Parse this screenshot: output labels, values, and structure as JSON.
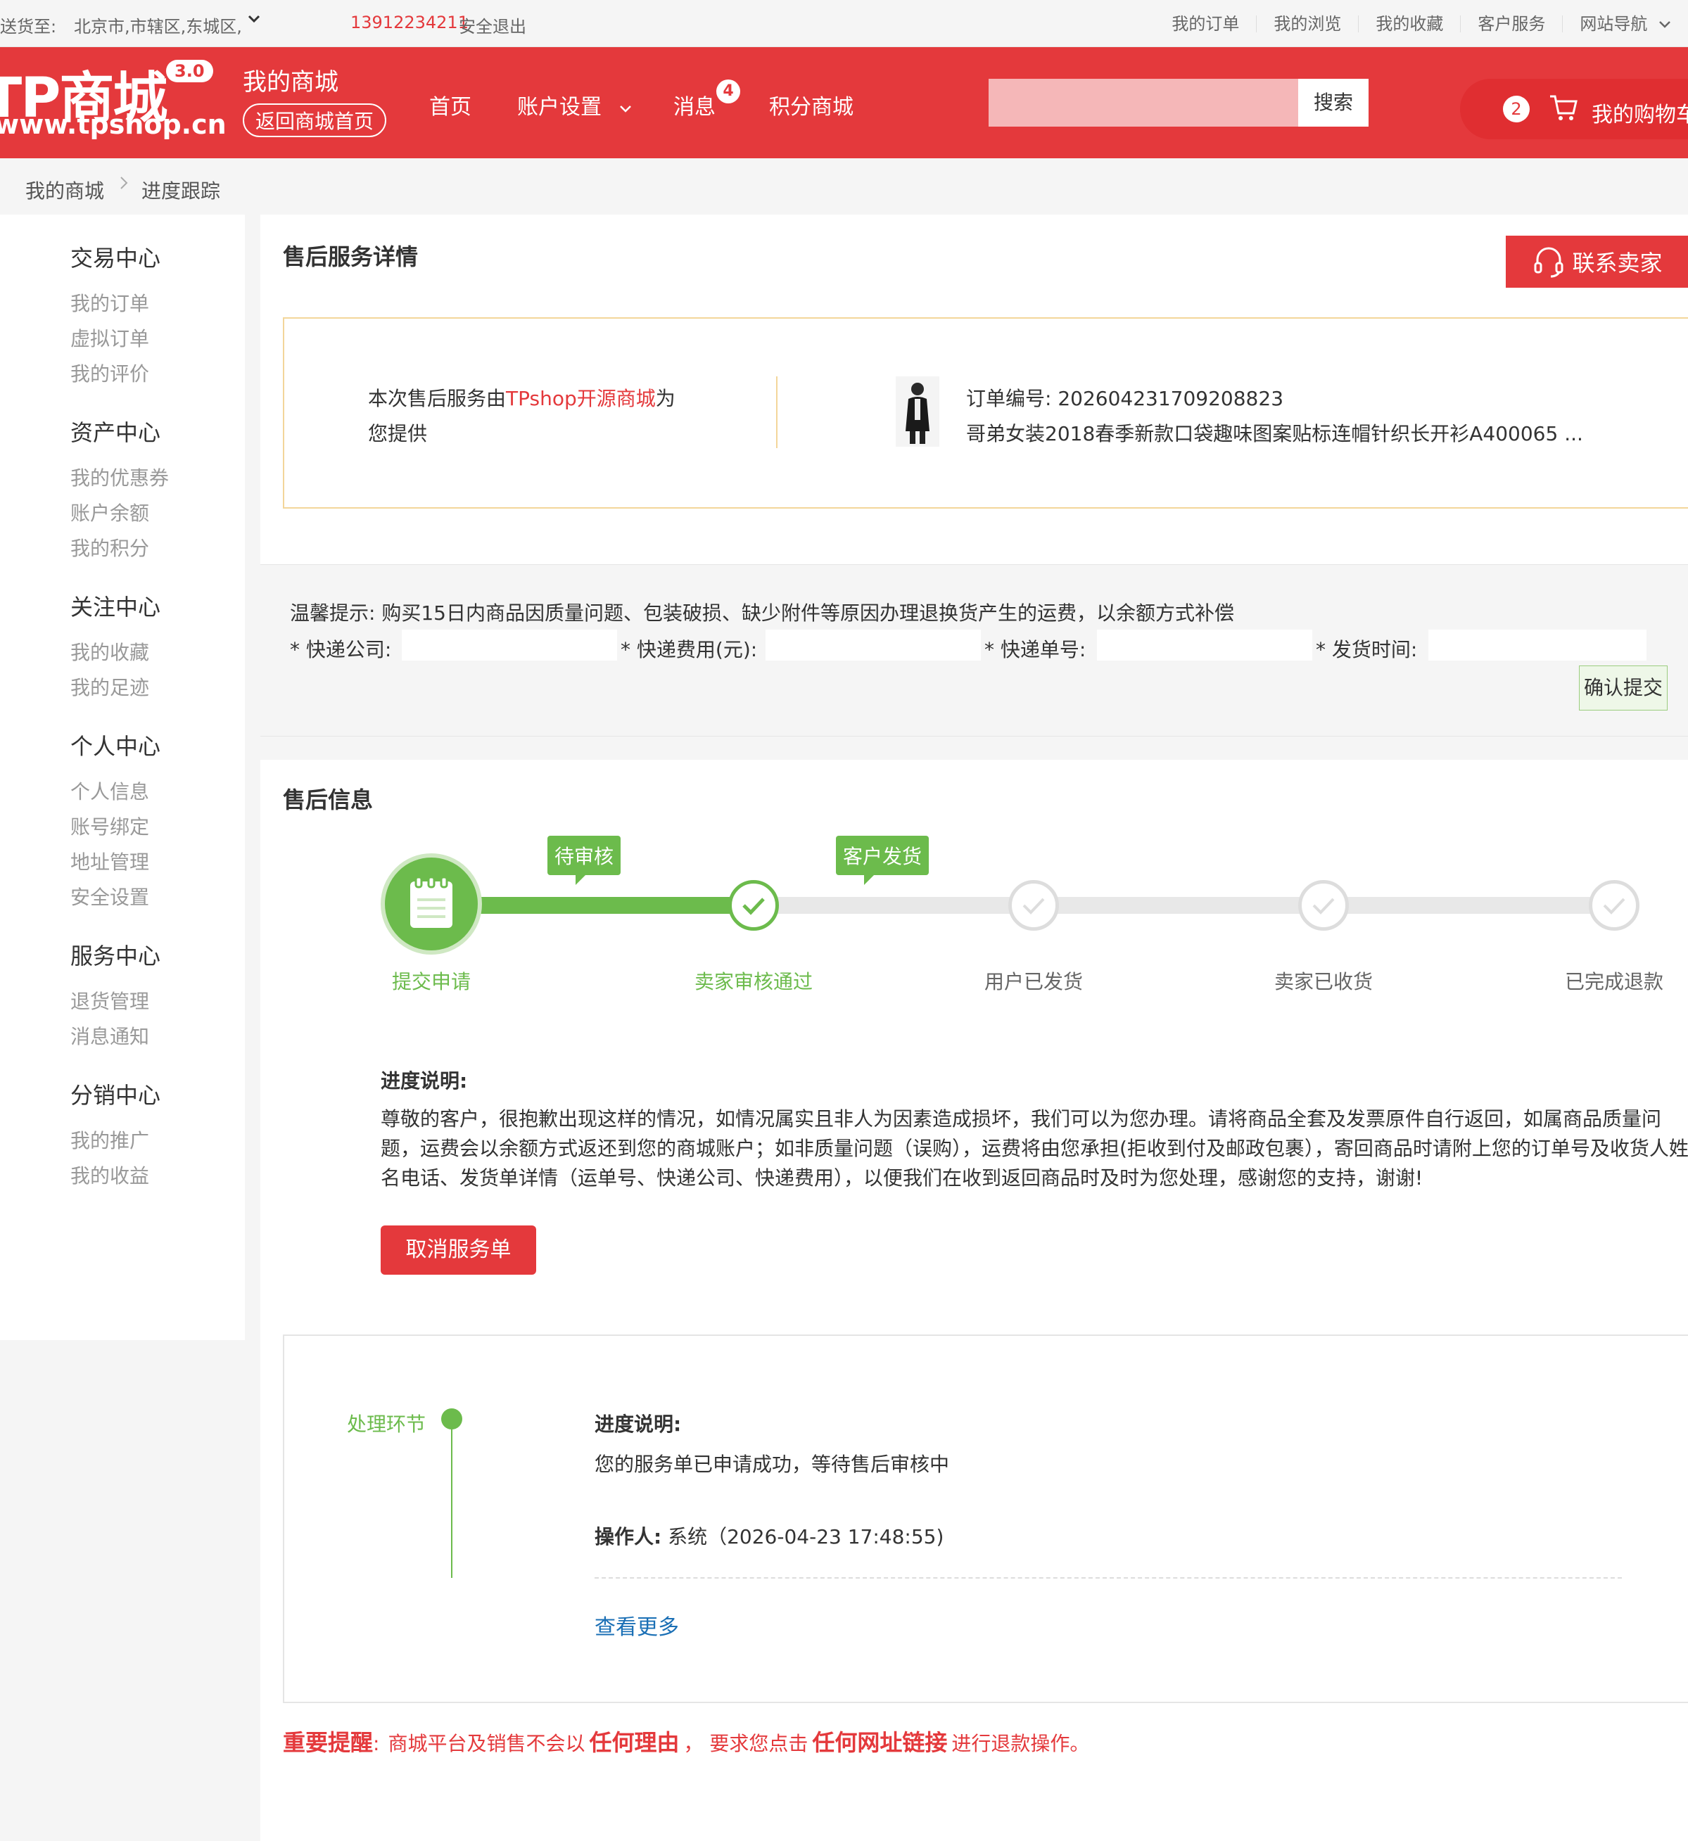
{
  "topbar": {
    "ship_to_label": "送货至:",
    "address": "北京市,市辖区,东城区,",
    "phone": "13912234211",
    "logout": "安全退出",
    "links": [
      "我的订单",
      "我的浏览",
      "我的收藏",
      "客户服务",
      "网站导航"
    ]
  },
  "header": {
    "logo_text": "TP商城",
    "logo_version": "3.0",
    "logo_url": "www.tpshop.cn",
    "my_mall": "我的商城",
    "back_home": "返回商城首页",
    "nav": {
      "home": "首页",
      "account": "账户设置",
      "messages": "消息",
      "points_mall": "积分商城"
    },
    "message_count": "4",
    "search_button": "搜索",
    "search_value": "",
    "cart_count": "2",
    "cart_label": "我的购物车",
    "brand_color": "#e4393c"
  },
  "breadcrumb": {
    "root": "我的商城",
    "current": "进度跟踪"
  },
  "sidebar": {
    "groups": [
      {
        "title": "交易中心",
        "items": [
          "我的订单",
          "虚拟订单",
          "我的评价"
        ]
      },
      {
        "title": "资产中心",
        "items": [
          "我的优惠券",
          "账户余额",
          "我的积分"
        ]
      },
      {
        "title": "关注中心",
        "items": [
          "我的收藏",
          "我的足迹"
        ]
      },
      {
        "title": "个人中心",
        "items": [
          "个人信息",
          "账号绑定",
          "地址管理",
          "安全设置"
        ]
      },
      {
        "title": "服务中心",
        "items": [
          "退货管理",
          "消息通知"
        ]
      },
      {
        "title": "分销中心",
        "items": [
          "我的推广",
          "我的收益"
        ]
      }
    ]
  },
  "detail": {
    "title": "售后服务详情",
    "contact_seller": "联系卖家",
    "provider_prefix": "本次售后服务由",
    "provider_name": "TPshop开源商城",
    "provider_suffix": "为",
    "provider_line2": "您提供",
    "order_no_label": "订单编号:",
    "order_no": "202604231709208823",
    "product_name": "哥弟女装2018春季新款口袋趣味图案贴标连帽针织长开衫A400065 ..."
  },
  "shipping_form": {
    "tip": "温馨提示:  购买15日内商品因质量问题、包装破损、缺少附件等原因办理退换货产生的运费，以余额方式补偿",
    "courier_label": "* 快递公司:",
    "fee_label": "* 快递费用(元):",
    "tracking_label": "* 快递单号:",
    "ship_time_label": "* 发货时间:",
    "courier_value": "",
    "fee_value": "",
    "tracking_value": "",
    "ship_time_value": "",
    "submit": "确认提交"
  },
  "aftersale": {
    "title": "售后信息",
    "steps": [
      "提交申请",
      "卖家审核通过",
      "用户已发货",
      "卖家已收货",
      "已完成退款"
    ],
    "completed_steps": 2,
    "tag_pending_review": "待审核",
    "tag_customer_ship": "客户发货",
    "progress_title": "进度说明:",
    "progress_text": "尊敬的客户，很抱歉出现这样的情况，如情况属实且非人为因素造成损坏，我们可以为您办理。请将商品全套及发票原件自行返回，如属商品质量问题，运费会以余额方式返还到您的商城账户；如非质量问题（误购），运费将由您承担(拒收到付及邮政包裹），寄回商品时请附上您的订单号及收货人姓名电话、发货单详情（运单号、快递公司、快递费用），以便我们在收到返回商品时及时为您处理，感谢您的支持，谢谢!",
    "cancel_button": "取消服务单",
    "accent_color": "#6cbb4c"
  },
  "log": {
    "stage_label": "处理环节",
    "progress_title": "进度说明:",
    "progress_text": "您的服务单已申请成功，等待售后审核中",
    "operator_label": "操作人:",
    "operator_value": "系统（2026-04-23 17:48:55)",
    "more": "查看更多"
  },
  "warning": {
    "title": "重要提醒",
    "sep": ":",
    "text1": "商城平台及销售不会以",
    "strong1": "任何理由",
    "text2": "，  要求您点击",
    "strong2": "任何网址链接",
    "text3": "进行退款操作。"
  }
}
